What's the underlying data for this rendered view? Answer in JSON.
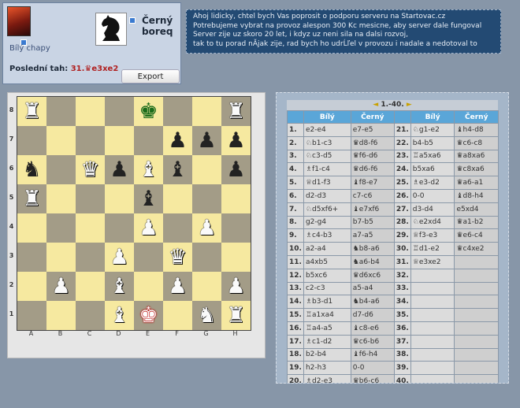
{
  "players": {
    "white_name": "Bílý chapy",
    "black_name": "Černý boreq",
    "last_move_label": "Poslední tah:",
    "last_move_number": "31.",
    "last_move": "♛e3xe2",
    "export_label": "Export"
  },
  "message": [
    "Ahoj lidicky, chtel bych Vas poprosit o podporu serveru na Startovac.cz",
    "Potrebujeme vybrat na provoz alespon 300 Kc mesicne, aby server dale fungoval",
    "Server zije uz skoro 20 let, i kdyz uz neni sila na dalsi rozvoj,",
    "tak to tu porad nĂ­jak zije, rad bych ho udrĹľel v provozu i nadale a nedotoval to"
  ],
  "board": {
    "files": [
      "A",
      "B",
      "C",
      "D",
      "E",
      "F",
      "G",
      "H"
    ],
    "ranks": [
      "8",
      "7",
      "6",
      "5",
      "4",
      "3",
      "2",
      "1"
    ]
  },
  "moves": {
    "nav": {
      "prev": "◄",
      "range": "1.-40.",
      "next": "►"
    },
    "headers": {
      "white": "Bílý",
      "black": "Černý"
    },
    "rows": [
      {
        "n": "1.",
        "w": "e2-e4",
        "b": "e7-e5",
        "n2": "21.",
        "w2": "♘g1-e2",
        "b2": "♝h4-d8"
      },
      {
        "n": "2.",
        "w": "♘b1-c3",
        "b": "♛d8-f6",
        "n2": "22.",
        "w2": "b4-b5",
        "b2": "♛c6-c8"
      },
      {
        "n": "3.",
        "w": "♘c3-d5",
        "b": "♛f6-d6",
        "n2": "23.",
        "w2": "♖a5xa6",
        "b2": "♛a8xa6"
      },
      {
        "n": "4.",
        "w": "♗f1-c4",
        "b": "♛d6-f6",
        "n2": "24.",
        "w2": "b5xa6",
        "b2": "♛c8xa6"
      },
      {
        "n": "5.",
        "w": "♕d1-f3",
        "b": "♝f8-e7",
        "n2": "25.",
        "w2": "♗e3-d2",
        "b2": "♛a6-a1"
      },
      {
        "n": "6.",
        "w": "d2-d3",
        "b": "c7-c6",
        "n2": "26.",
        "w2": "0-0",
        "b2": "♝d8-h4"
      },
      {
        "n": "7.",
        "w": "♘d5xf6+",
        "b": "♝e7xf6",
        "n2": "27.",
        "w2": "d3-d4",
        "b2": "e5xd4"
      },
      {
        "n": "8.",
        "w": "g2-g4",
        "b": "b7-b5",
        "n2": "28.",
        "w2": "♘e2xd4",
        "b2": "♛a1-b2"
      },
      {
        "n": "9.",
        "w": "♗c4-b3",
        "b": "a7-a5",
        "n2": "29.",
        "w2": "♕f3-e3",
        "b2": "♛e6-c4"
      },
      {
        "n": "10.",
        "w": "a2-a4",
        "b": "♞b8-a6",
        "n2": "30.",
        "w2": "♖d1-e2",
        "b2": "♛c4xe2"
      },
      {
        "n": "11.",
        "w": "a4xb5",
        "b": "♞a6-b4",
        "n2": "31.",
        "w2": "♕e3xe2",
        "b2": ""
      },
      {
        "n": "12.",
        "w": "b5xc6",
        "b": "♛d6xc6",
        "n2": "32.",
        "w2": "",
        "b2": ""
      },
      {
        "n": "13.",
        "w": "c2-c3",
        "b": "a5-a4",
        "n2": "33.",
        "w2": "",
        "b2": ""
      },
      {
        "n": "14.",
        "w": "♗b3-d1",
        "b": "♞b4-a6",
        "n2": "34.",
        "w2": "",
        "b2": ""
      },
      {
        "n": "15.",
        "w": "♖a1xa4",
        "b": "d7-d6",
        "n2": "35.",
        "w2": "",
        "b2": ""
      },
      {
        "n": "16.",
        "w": "♖a4-a5",
        "b": "♝c8-e6",
        "n2": "36.",
        "w2": "",
        "b2": ""
      },
      {
        "n": "17.",
        "w": "♗c1-d2",
        "b": "♛c6-b6",
        "n2": "37.",
        "w2": "",
        "b2": ""
      },
      {
        "n": "18.",
        "w": "b2-b4",
        "b": "♝f6-h4",
        "n2": "38.",
        "w2": "",
        "b2": ""
      },
      {
        "n": "19.",
        "w": "h2-h3",
        "b": "0-0",
        "n2": "39.",
        "w2": "",
        "b2": ""
      },
      {
        "n": "20.",
        "w": "♗d2-e3",
        "b": "♛b6-c6",
        "n2": "40.",
        "w2": "",
        "b2": ""
      }
    ]
  }
}
